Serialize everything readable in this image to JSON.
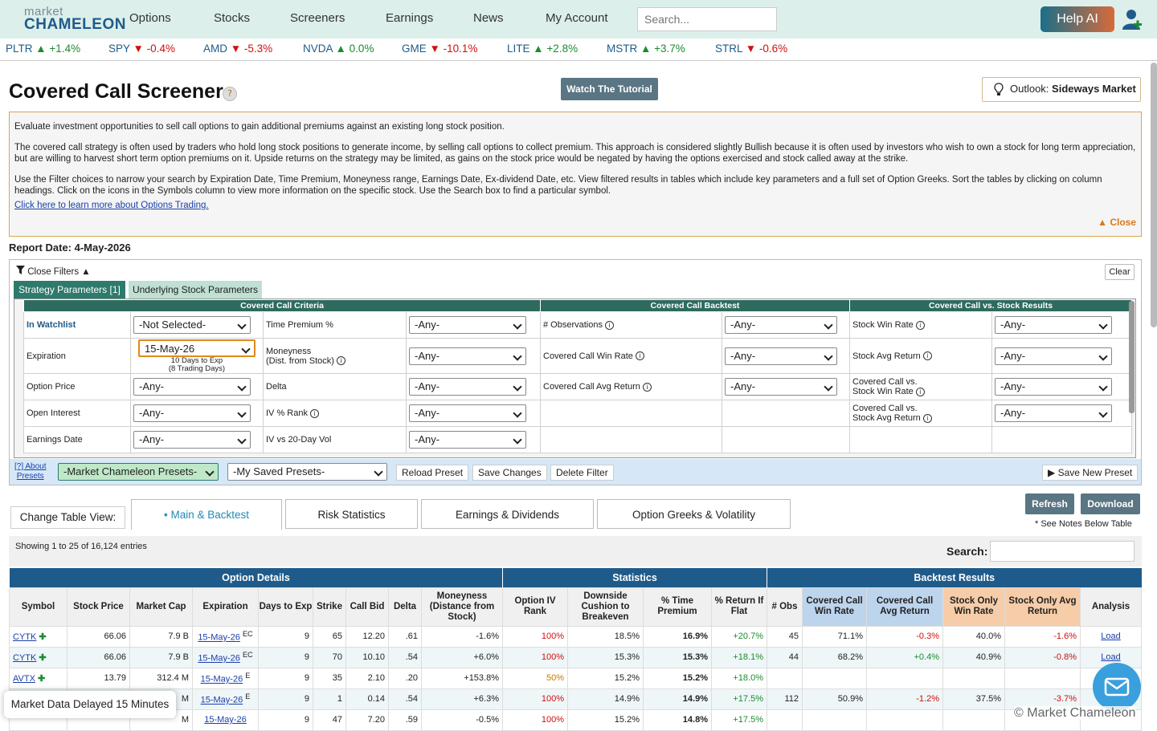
{
  "nav": {
    "logo_top": "market",
    "logo_bottom": "CHAMELEON",
    "items": [
      "Options",
      "Stocks",
      "Screeners",
      "Earnings",
      "News",
      "My Account"
    ],
    "search_placeholder": "Search...",
    "help": "Help AI"
  },
  "ticker": [
    {
      "sym": "PLTR",
      "dir": "▲",
      "chg": "+1.4%",
      "cls": "up"
    },
    {
      "sym": "SPY",
      "dir": "▼",
      "chg": "-0.4%",
      "cls": "dn"
    },
    {
      "sym": "AMD",
      "dir": "▼",
      "chg": "-5.3%",
      "cls": "dn"
    },
    {
      "sym": "NVDA",
      "dir": "▲",
      "chg": "0.0%",
      "cls": "up"
    },
    {
      "sym": "GME",
      "dir": "▼",
      "chg": "-10.1%",
      "cls": "dn"
    },
    {
      "sym": "LITE",
      "dir": "▲",
      "chg": "+2.8%",
      "cls": "up"
    },
    {
      "sym": "MSTR",
      "dir": "▲",
      "chg": "+3.7%",
      "cls": "up"
    },
    {
      "sym": "STRL",
      "dir": "▼",
      "chg": "-0.6%",
      "cls": "dn"
    }
  ],
  "page": {
    "title": "Covered Call Screener",
    "tutorial": "Watch The Tutorial",
    "outlook_label": "Outlook:",
    "outlook_value": "Sideways Market",
    "report_date": "Report Date: 4-May-2026"
  },
  "info": {
    "p1": "Evaluate investment opportunities to sell call options to gain additional premiums against an existing long stock position.",
    "p2": "The covered call strategy is often used by traders who hold long stock positions to generate income, by selling call options to collect premium. This approach is considered slightly Bullish because it is often used by investors who wish to own a stock for long term appreciation, but are willing to harvest short term option premiums on it. Upside returns on the strategy may be limited, as gains on the stock price would be negated by having the options exercised and stock called away at the strike.",
    "p3": "Use the Filter choices to narrow your search by Expiration Date, Time Premium, Moneyness range, Earnings Date, Ex-dividend Date, etc. View filtered results in tables which include key parameters and a full set of Option Greeks. Sort the tables by clicking on column headings. Click on the icons in the Symbols column to view more information on the specific stock. Use the Search box to find a particular symbol.",
    "link": "Click here to learn more about Options Trading.",
    "close": "▲ Close"
  },
  "filters": {
    "close": "Close Filters",
    "clear": "Clear",
    "tab_strategy": "Strategy Parameters [1]",
    "tab_underlying": "Underlying Stock Parameters",
    "groups": [
      "Covered Call Criteria",
      "Covered Call Backtest",
      "Covered Call vs. Stock Results"
    ],
    "any": "-Any-",
    "rows": [
      {
        "a": "In Watchlist",
        "av": "-Not Selected-",
        "b": "Time Premium %",
        "c": "# Observations",
        "d": "Stock Win Rate"
      },
      {
        "a": "Expiration",
        "av": "15-May-26",
        "note1": "10 Days to Exp",
        "note2": "(8 Trading Days)",
        "b": "Moneyness",
        "b2": "(Dist. from Stock)",
        "c": "Covered Call Win Rate",
        "d": "Stock Avg Return"
      },
      {
        "a": "Option Price",
        "b": "Delta",
        "c": "Covered Call Avg Return",
        "d": "Covered Call vs.",
        "d2": "Stock Win Rate"
      },
      {
        "a": "Open Interest",
        "b": "IV % Rank",
        "d": "Covered Call vs.",
        "d2": "Stock Avg Return"
      },
      {
        "a": "Earnings Date",
        "b": "IV vs 20-Day Vol"
      }
    ],
    "about": "[?] About",
    "presets": "Presets",
    "mc_presets": "-Market Chameleon Presets-",
    "my_presets": "-My Saved Presets-",
    "reload": "Reload Preset",
    "save": "Save Changes",
    "delete": "Delete Filter",
    "save_new": "Save New Preset"
  },
  "view": {
    "label": "Change Table View:",
    "tabs": [
      "Main & Backtest",
      "Risk Statistics",
      "Earnings & Dividends",
      "Option Greeks & Volatility"
    ],
    "refresh": "Refresh",
    "download": "Download",
    "notes": "* See Notes Below Table",
    "showing": "Showing 1 to 25 of 16,124 entries",
    "search": "Search:"
  },
  "table": {
    "groups": [
      "Option Details",
      "Statistics",
      "Backtest Results"
    ],
    "cols": [
      "Symbol",
      "Stock Price",
      "Market Cap",
      "Expiration",
      "Days to Exp",
      "Strike",
      "Call Bid",
      "Delta",
      "Moneyness (Distance from Stock)",
      "Option IV Rank",
      "Downside Cushion to Breakeven",
      "% Time Premium",
      "% Return If Flat",
      "# Obs",
      "Covered Call Win Rate",
      "Covered Call Avg Return",
      "Stock Only Win Rate",
      "Stock Only Avg Return",
      "Analysis"
    ],
    "rows": [
      [
        "CYTK",
        "66.06",
        "7.9 B",
        "15-May-26",
        "EC",
        "9",
        "65",
        "12.20",
        ".61",
        "-1.6%",
        "100%",
        "18.5%",
        "16.9%",
        "+20.7%",
        "45",
        "71.1%",
        "-0.3%",
        "40.0%",
        "-1.6%",
        "Load"
      ],
      [
        "CYTK",
        "66.06",
        "7.9 B",
        "15-May-26",
        "EC",
        "9",
        "70",
        "10.10",
        ".54",
        "+6.0%",
        "100%",
        "15.3%",
        "15.3%",
        "+18.1%",
        "44",
        "68.2%",
        "+0.4%",
        "40.9%",
        "-0.8%",
        "Load"
      ],
      [
        "AVTX",
        "13.79",
        "312.4 M",
        "15-May-26",
        "E",
        "9",
        "35",
        "2.10",
        ".20",
        "+153.8%",
        "50%",
        "15.2%",
        "15.2%",
        "+18.0%",
        "",
        "",
        "",
        "",
        "",
        ""
      ],
      [
        "",
        "",
        "M",
        "15-May-26",
        "E",
        "9",
        "1",
        "0.14",
        ".54",
        "+6.3%",
        "100%",
        "14.9%",
        "14.9%",
        "+17.5%",
        "112",
        "50.9%",
        "-1.2%",
        "37.5%",
        "-3.7%",
        ""
      ],
      [
        "",
        "",
        "M",
        "15-May-26",
        "",
        "9",
        "47",
        "7.20",
        ".59",
        "-0.5%",
        "100%",
        "15.2%",
        "14.8%",
        "+17.5%",
        "",
        "",
        "",
        "",
        "",
        ""
      ]
    ]
  },
  "footer": {
    "delay": "Market Data Delayed 15 Minutes",
    "copyright": "© Market Chameleon"
  }
}
